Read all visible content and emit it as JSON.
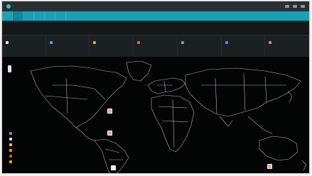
{
  "app": {
    "title": "",
    "window_icon": "app-icon"
  },
  "nav": {
    "items": [
      {
        "label": ""
      },
      {
        "label": ""
      },
      {
        "label": ""
      },
      {
        "label": ""
      },
      {
        "label": ""
      },
      {
        "label": ""
      }
    ]
  },
  "header": {
    "title": "",
    "subtitle": "",
    "right_label": ""
  },
  "filters": [
    {
      "label": "",
      "value": "",
      "color": "#e6e6e6"
    },
    {
      "label": "",
      "value": "",
      "color": "#3fa7d6"
    },
    {
      "label": "",
      "value": "",
      "color": "#e8a23b"
    },
    {
      "label": "",
      "value": "",
      "color": "#d36b6b"
    },
    {
      "label": "",
      "value": "",
      "color": "#8c9aa0"
    },
    {
      "label": "",
      "value": "",
      "color": "#5b8dd9"
    },
    {
      "label": "",
      "value": "",
      "color": "#d77ab8"
    }
  ],
  "map": {
    "legend": [
      {
        "label": "",
        "color": "#3fa7d6"
      },
      {
        "label": "",
        "color": "#e6e6e6"
      },
      {
        "label": "",
        "color": "#e8c13b"
      },
      {
        "label": "",
        "color": "#f08a5d"
      },
      {
        "label": "",
        "color": "#d9534f"
      },
      {
        "label": "",
        "color": "#e8a23b"
      }
    ],
    "markers": [
      {
        "name": "north-america-marker",
        "color": "#f2a0a0"
      },
      {
        "name": "central-america-marker",
        "color": "#f2a0a0"
      },
      {
        "name": "south-america-marker",
        "color": "#e6f4f7"
      },
      {
        "name": "oceania-marker",
        "color": "#f2a0a0"
      }
    ]
  }
}
